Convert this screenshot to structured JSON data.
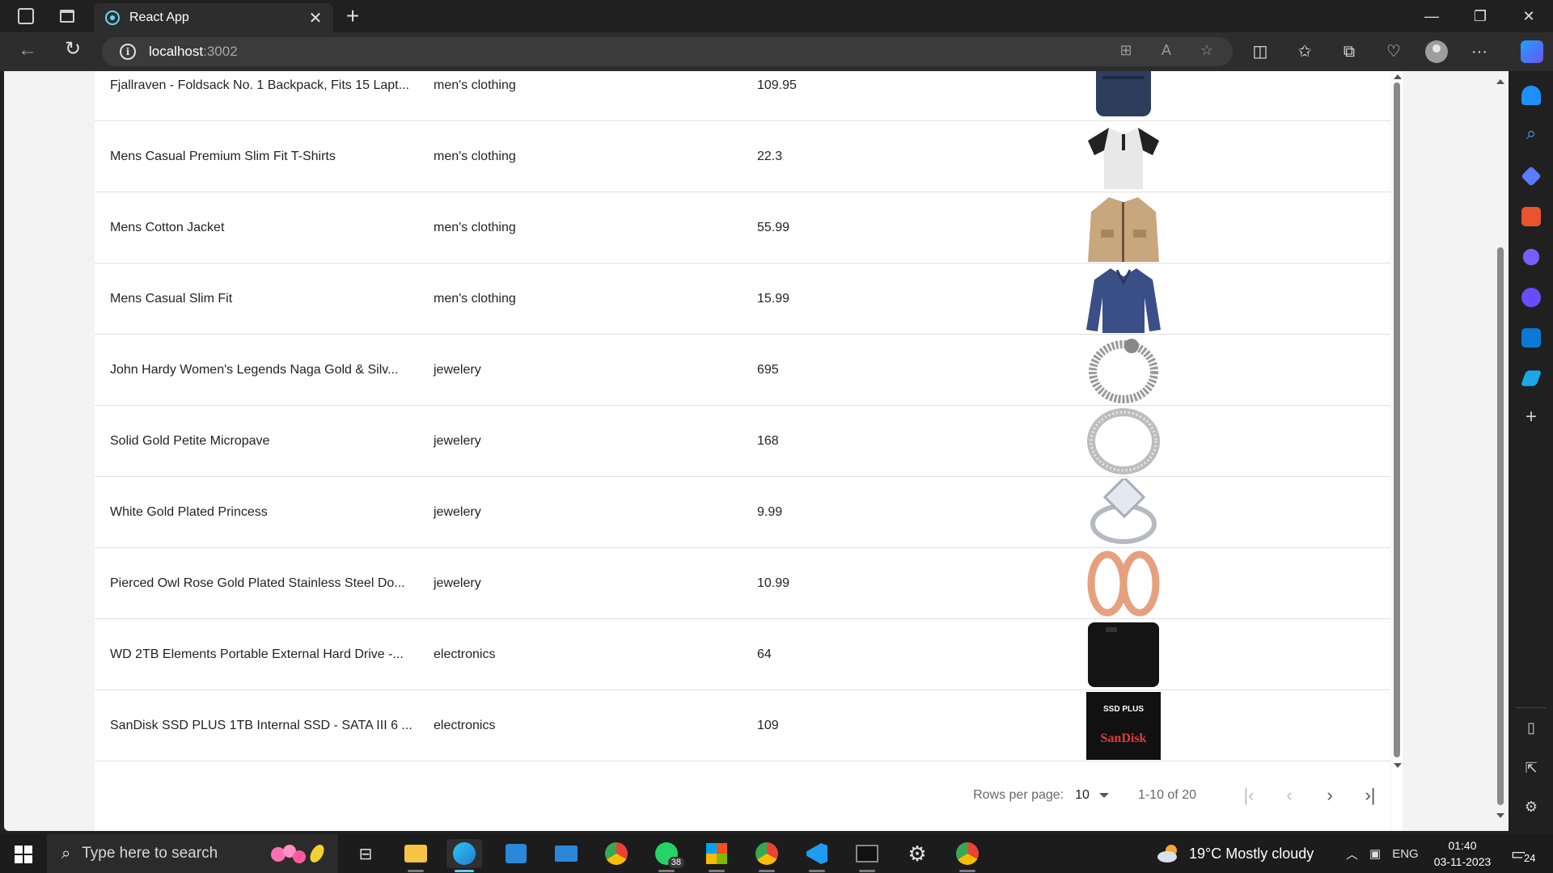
{
  "browser": {
    "tab_title": "React App",
    "url_host": "localhost",
    "url_port": ":3002"
  },
  "table": {
    "rows": [
      {
        "title": "Fjallraven - Foldsack No. 1 Backpack, Fits 15 Lapt...",
        "category": "men's clothing",
        "price": "109.95",
        "image": "backpack"
      },
      {
        "title": "Mens Casual Premium Slim Fit T-Shirts",
        "category": "men's clothing",
        "price": "22.3",
        "image": "tshirt"
      },
      {
        "title": "Mens Cotton Jacket",
        "category": "men's clothing",
        "price": "55.99",
        "image": "jacket"
      },
      {
        "title": "Mens Casual Slim Fit",
        "category": "men's clothing",
        "price": "15.99",
        "image": "longsleeve"
      },
      {
        "title": "John Hardy Women's Legends Naga Gold & Silv...",
        "category": "jewelery",
        "price": "695",
        "image": "bracelet"
      },
      {
        "title": "Solid Gold Petite Micropave",
        "category": "jewelery",
        "price": "168",
        "image": "ring"
      },
      {
        "title": "White Gold Plated Princess",
        "category": "jewelery",
        "price": "9.99",
        "image": "diamond-ring"
      },
      {
        "title": "Pierced Owl Rose Gold Plated Stainless Steel Do...",
        "category": "jewelery",
        "price": "10.99",
        "image": "earrings"
      },
      {
        "title": "WD 2TB Elements Portable External Hard Drive -...",
        "category": "electronics",
        "price": "64",
        "image": "hard-drive"
      },
      {
        "title": "SanDisk SSD PLUS 1TB Internal SSD - SATA III 6 ...",
        "category": "electronics",
        "price": "109",
        "image": "ssd"
      }
    ]
  },
  "pagination": {
    "rows_per_page_label": "Rows per page:",
    "rows_per_page_value": "10",
    "displayed_rows": "1-10 of 20"
  },
  "ssd_label": {
    "top": "SSD PLUS",
    "brand": "SanDisk"
  },
  "taskbar": {
    "search_placeholder": "Type here to search",
    "whatsapp_badge": "38",
    "weather": "19°C  Mostly cloudy",
    "language": "ENG",
    "time": "01:40",
    "date": "03-11-2023",
    "notifications": "24"
  },
  "colors": {
    "accent": "#60cdff",
    "content_bg": "#f3f3f3",
    "table_bg": "#ffffff"
  }
}
